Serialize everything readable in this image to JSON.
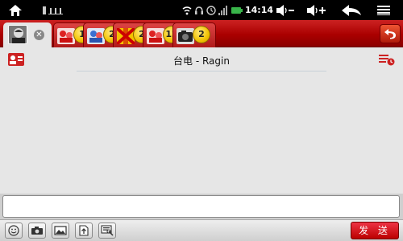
{
  "status_bar": {
    "time": "14:14",
    "icons": [
      "home-icon",
      "usb-icon",
      "wifi-icon",
      "headset-icon",
      "alarm-icon",
      "signal-icon",
      "battery-icon",
      "volume-down-icon",
      "volume-up-icon",
      "back-icon",
      "menu-icon"
    ]
  },
  "tabs": [
    {
      "kind": "active-contact",
      "icon": "avatar"
    },
    {
      "kind": "group",
      "icon": "group-red-icon",
      "badge": "1"
    },
    {
      "kind": "group",
      "icon": "group-blue-icon",
      "badge": "2"
    },
    {
      "kind": "group",
      "icon": "group-scotland-icon",
      "badge": "2"
    },
    {
      "kind": "group",
      "icon": "group-red-icon",
      "badge": "12"
    },
    {
      "kind": "group",
      "icon": "group-camera-icon",
      "badge": "2"
    }
  ],
  "chat": {
    "title": "台电 - Ragin"
  },
  "composer": {
    "message_value": "",
    "send_label": "发 送"
  },
  "toolbar_icons": [
    "emoji-icon",
    "camera-icon",
    "image-icon",
    "upload-file-icon",
    "screenshot-icon"
  ],
  "colors": {
    "accent": "#b01010",
    "badge": "#f2c200"
  }
}
